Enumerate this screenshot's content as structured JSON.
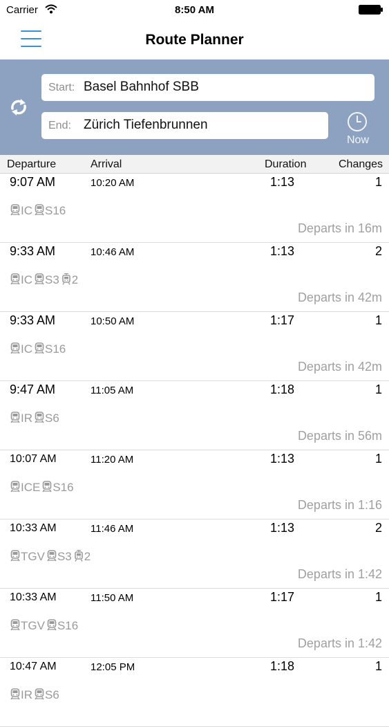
{
  "status_bar": {
    "carrier": "Carrier",
    "time": "8:50 AM"
  },
  "nav": {
    "title": "Route Planner"
  },
  "search": {
    "start_label": "Start:",
    "start_value": "Basel Bahnhof SBB",
    "end_label": "End:",
    "end_value": "Zürich Tiefenbrunnen",
    "now_label": "Now"
  },
  "columns": {
    "departure": "Departure",
    "arrival": "Arrival",
    "duration": "Duration",
    "changes": "Changes"
  },
  "connections": [
    {
      "departure": "9:07 AM",
      "arrival": "10:20 AM",
      "duration": "1:13",
      "changes": "1",
      "legs": [
        {
          "icon": "train-icon",
          "label": "IC"
        },
        {
          "icon": "train-icon",
          "label": "S16"
        }
      ],
      "departs_in": "Departs in 16m"
    },
    {
      "departure": "9:33 AM",
      "arrival": "10:46 AM",
      "duration": "1:13",
      "changes": "2",
      "legs": [
        {
          "icon": "train-icon",
          "label": "IC"
        },
        {
          "icon": "train-icon",
          "label": "S3"
        },
        {
          "icon": "tram-icon",
          "label": "2"
        }
      ],
      "departs_in": "Departs in 42m"
    },
    {
      "departure": "9:33 AM",
      "arrival": "10:50 AM",
      "duration": "1:17",
      "changes": "1",
      "legs": [
        {
          "icon": "train-icon",
          "label": "IC"
        },
        {
          "icon": "train-icon",
          "label": "S16"
        }
      ],
      "departs_in": "Departs in 42m"
    },
    {
      "departure": "9:47 AM",
      "arrival": "11:05 AM",
      "duration": "1:18",
      "changes": "1",
      "legs": [
        {
          "icon": "train-icon",
          "label": "IR"
        },
        {
          "icon": "train-icon",
          "label": "S6"
        }
      ],
      "departs_in": "Departs in 56m"
    },
    {
      "departure": "10:07 AM",
      "arrival": "11:20 AM",
      "duration": "1:13",
      "changes": "1",
      "legs": [
        {
          "icon": "train-icon",
          "label": "ICE"
        },
        {
          "icon": "train-icon",
          "label": "S16"
        }
      ],
      "departs_in": "Departs in 1:16"
    },
    {
      "departure": "10:33 AM",
      "arrival": "11:46 AM",
      "duration": "1:13",
      "changes": "2",
      "legs": [
        {
          "icon": "train-icon",
          "label": "TGV"
        },
        {
          "icon": "train-icon",
          "label": "S3"
        },
        {
          "icon": "tram-icon",
          "label": "2"
        }
      ],
      "departs_in": "Departs in 1:42"
    },
    {
      "departure": "10:33 AM",
      "arrival": "11:50 AM",
      "duration": "1:17",
      "changes": "1",
      "legs": [
        {
          "icon": "train-icon",
          "label": "TGV"
        },
        {
          "icon": "train-icon",
          "label": "S16"
        }
      ],
      "departs_in": "Departs in 1:42"
    },
    {
      "departure": "10:47 AM",
      "arrival": "12:05 PM",
      "duration": "1:18",
      "changes": "1",
      "legs": [
        {
          "icon": "train-icon",
          "label": "IR"
        },
        {
          "icon": "train-icon",
          "label": "S6"
        }
      ],
      "departs_in": ""
    }
  ],
  "colors": {
    "accent": "#3a8fd6",
    "panel": "#8da1c1",
    "muted": "#9a9a9a"
  }
}
